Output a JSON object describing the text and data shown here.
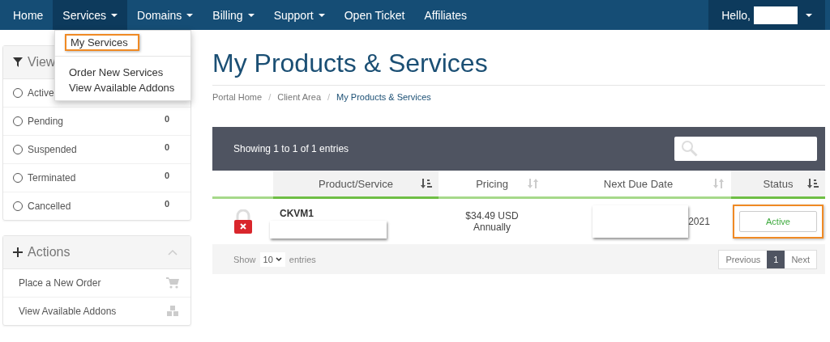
{
  "navbar": {
    "items": [
      {
        "label": "Home",
        "dropdown": false,
        "expanded": false
      },
      {
        "label": "Services",
        "dropdown": true,
        "expanded": true
      },
      {
        "label": "Domains",
        "dropdown": true,
        "expanded": false
      },
      {
        "label": "Billing",
        "dropdown": true,
        "expanded": false
      },
      {
        "label": "Support",
        "dropdown": true,
        "expanded": false
      },
      {
        "label": "Open Ticket",
        "dropdown": false,
        "expanded": false
      },
      {
        "label": "Affiliates",
        "dropdown": false,
        "expanded": false
      }
    ],
    "user": {
      "greeting": "Hello,",
      "redacted": true
    }
  },
  "services_menu": [
    {
      "label": "My Services",
      "highlighted": true
    },
    {
      "label": "Order New Services",
      "highlighted": false
    },
    {
      "label": "View Available Addons",
      "highlighted": false
    }
  ],
  "filter_panel": {
    "title": "View",
    "items": [
      {
        "label": "Active",
        "selected": false
      },
      {
        "label": "Pending",
        "count": "0",
        "selected": false
      },
      {
        "label": "Suspended",
        "count": "0",
        "selected": false
      },
      {
        "label": "Terminated",
        "count": "0",
        "selected": false
      },
      {
        "label": "Cancelled",
        "count": "0",
        "selected": false
      }
    ]
  },
  "actions_panel": {
    "title": "Actions",
    "items": [
      {
        "label": "Place a New Order",
        "kind": "cart"
      },
      {
        "label": "View Available Addons",
        "kind": "cubes"
      }
    ]
  },
  "page_title": "My Products & Services",
  "breadcrumb": [
    {
      "label": "Portal Home",
      "current": false
    },
    {
      "label": "Client Area",
      "current": false
    },
    {
      "label": "My Products & Services",
      "current": true
    }
  ],
  "breadcrumb_separator": "/",
  "table": {
    "info": "Showing 1 to 1 of 1 entries",
    "columns": [
      {
        "label": "Product/Service",
        "sorted": true
      },
      {
        "label": "Pricing",
        "sorted": false
      },
      {
        "label": "Next Due Date",
        "sorted": false
      },
      {
        "label": "Status",
        "sorted": true
      }
    ],
    "rows": [
      {
        "product": "CKVM1",
        "detail_redacted": true,
        "price": "$34.49 USD",
        "cycle": "Annually",
        "due": "2021",
        "due_redacted": true,
        "status": "Active",
        "status_highlighted": true
      }
    ],
    "length_label_before": "Show",
    "page_length": "10",
    "length_label_after": "entries",
    "pagination": [
      {
        "label": "Previous",
        "selected": false
      },
      {
        "label": "1",
        "selected": true
      },
      {
        "label": "Next",
        "selected": false
      }
    ]
  }
}
